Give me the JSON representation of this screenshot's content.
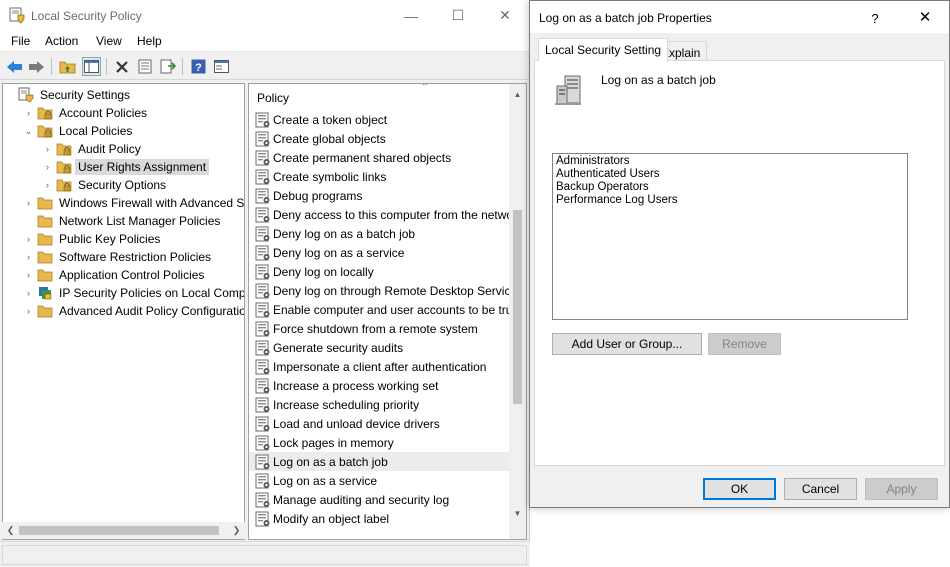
{
  "main_window": {
    "title": "Local Security Policy",
    "controls": {
      "minimize": "—",
      "maximize": "☐",
      "close": "✕"
    },
    "menu": [
      "File",
      "Action",
      "View",
      "Help"
    ],
    "toolbar_icons": [
      "back-arrow-icon",
      "forward-arrow-icon",
      "up-folder-icon",
      "show-hide-tree-icon",
      "delete-icon",
      "properties-icon",
      "export-list-icon",
      "help-icon",
      "console-tree-icon"
    ]
  },
  "tree": {
    "items": [
      {
        "label": "Security Settings",
        "expander": "",
        "depth": 0,
        "icon": "security-settings-icon"
      },
      {
        "label": "Account Policies",
        "expander": "›",
        "depth": 1,
        "icon": "folder-lock-icon"
      },
      {
        "label": "Local Policies",
        "expander": "⌄",
        "depth": 1,
        "icon": "folder-lock-icon"
      },
      {
        "label": "Audit Policy",
        "expander": "›",
        "depth": 2,
        "icon": "folder-lock-icon"
      },
      {
        "label": "User Rights Assignment",
        "expander": "›",
        "depth": 2,
        "icon": "folder-lock-icon",
        "selected": true
      },
      {
        "label": "Security Options",
        "expander": "›",
        "depth": 2,
        "icon": "folder-lock-icon"
      },
      {
        "label": "Windows Firewall with Advanced Security",
        "expander": "›",
        "depth": 1,
        "icon": "folder-icon"
      },
      {
        "label": "Network List Manager Policies",
        "expander": "",
        "depth": 1,
        "icon": "folder-icon"
      },
      {
        "label": "Public Key Policies",
        "expander": "›",
        "depth": 1,
        "icon": "folder-icon"
      },
      {
        "label": "Software Restriction Policies",
        "expander": "›",
        "depth": 1,
        "icon": "folder-icon"
      },
      {
        "label": "Application Control Policies",
        "expander": "›",
        "depth": 1,
        "icon": "folder-icon"
      },
      {
        "label": "IP Security Policies on Local Computer",
        "expander": "›",
        "depth": 1,
        "icon": "ip-security-icon"
      },
      {
        "label": "Advanced Audit Policy Configuration",
        "expander": "›",
        "depth": 1,
        "icon": "folder-icon"
      }
    ]
  },
  "policy_list": {
    "column_header": "Policy",
    "items": [
      "Create a token object",
      "Create global objects",
      "Create permanent shared objects",
      "Create symbolic links",
      "Debug programs",
      "Deny access to this computer from the network",
      "Deny log on as a batch job",
      "Deny log on as a service",
      "Deny log on locally",
      "Deny log on through Remote Desktop Services",
      "Enable computer and user accounts to be trusted for delegation",
      "Force shutdown from a remote system",
      "Generate security audits",
      "Impersonate a client after authentication",
      "Increase a process working set",
      "Increase scheduling priority",
      "Load and unload device drivers",
      "Lock pages in memory",
      "Log on as a batch job",
      "Log on as a service",
      "Manage auditing and security log",
      "Modify an object label"
    ],
    "selected": "Log on as a batch job"
  },
  "dialog": {
    "title": "Log on as a batch job Properties",
    "help": "?",
    "close": "✕",
    "tabs": [
      "Local Security Setting",
      "Explain"
    ],
    "active_tab": "Local Security Setting",
    "policy_name": "Log on as a batch job",
    "users": [
      "Administrators",
      "Authenticated Users",
      "Backup Operators",
      "Performance Log Users"
    ],
    "add_button": "Add User or Group...",
    "remove_button": "Remove",
    "ok_button": "OK",
    "cancel_button": "Cancel",
    "apply_button": "Apply"
  },
  "colors": {
    "accent": "#0078d7",
    "folder": "#e8b84a",
    "selection": "#d9d9d9"
  }
}
